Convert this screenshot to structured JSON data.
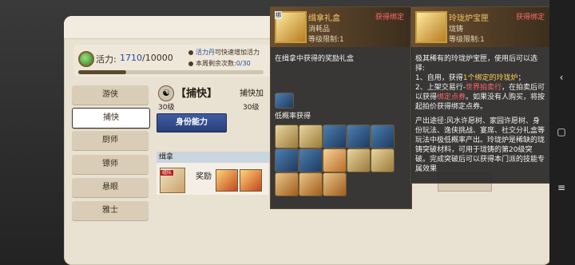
{
  "vigor": {
    "label": "活力:",
    "value": "1710",
    "max": "/10000",
    "hint_link": "活力丹",
    "hint_rest": "可快速增加活力",
    "remaining_label": "本周剩余次数:",
    "remaining_value": "0/30"
  },
  "sidebar": {
    "items": [
      {
        "label": "游侠"
      },
      {
        "label": "捕快"
      },
      {
        "label": "厨师"
      },
      {
        "label": "镖师"
      },
      {
        "label": "悬眼"
      },
      {
        "label": "雅士"
      }
    ]
  },
  "role": {
    "name": "【捕快】",
    "level": "30级",
    "bonus_label": "捕快加",
    "bonus_level": "30级",
    "ability_button": "身份能力"
  },
  "task": {
    "section_title": "缉拿",
    "team_badge": "组队",
    "reward_label": "奖励"
  },
  "tooltip_left": {
    "bind_tag": "绑",
    "title": "缉拿礼盒",
    "type": "消耗品",
    "level_req": "等级限制:1",
    "status": "获得绑定",
    "desc": "在缉拿中获得的奖励礼盒",
    "low_prob_label": "低概率获得"
  },
  "tooltip_right": {
    "title": "玲珑炉宝匣",
    "type": "珑铸",
    "level_req": "等级限制:1",
    "status": "获得绑定",
    "intro": "极其稀有的玲珑炉宝匣，使用后可以选择:",
    "opt1_a": "1、自用，获得",
    "opt1_b": "1个绑定的玲珑炉",
    "opt1_c": "；",
    "opt2_a": "2、上架交易行-",
    "opt2_b": "世界拍卖行",
    "opt2_c": "，在拍卖后可以获得",
    "opt2_d": "绑定点券",
    "opt2_e": "。如果没有人购买，将按起拍价获得绑定点券。",
    "source": "产出途径:风水许愿树、家园许愿树、身份玩法、逸侠挑战、宴席、社交分礼盒等玩法中极低概率产出。玲珑炉是稀缺的珑铸突破材料，可用于珑铸的第20级突破。完成突破后可以获得本门派的技能专属效果"
  },
  "colors": {
    "accent_blue": "#2a3f78",
    "tooltip_gold": "#f0c46a",
    "bind_red": "#ff6b6b"
  }
}
